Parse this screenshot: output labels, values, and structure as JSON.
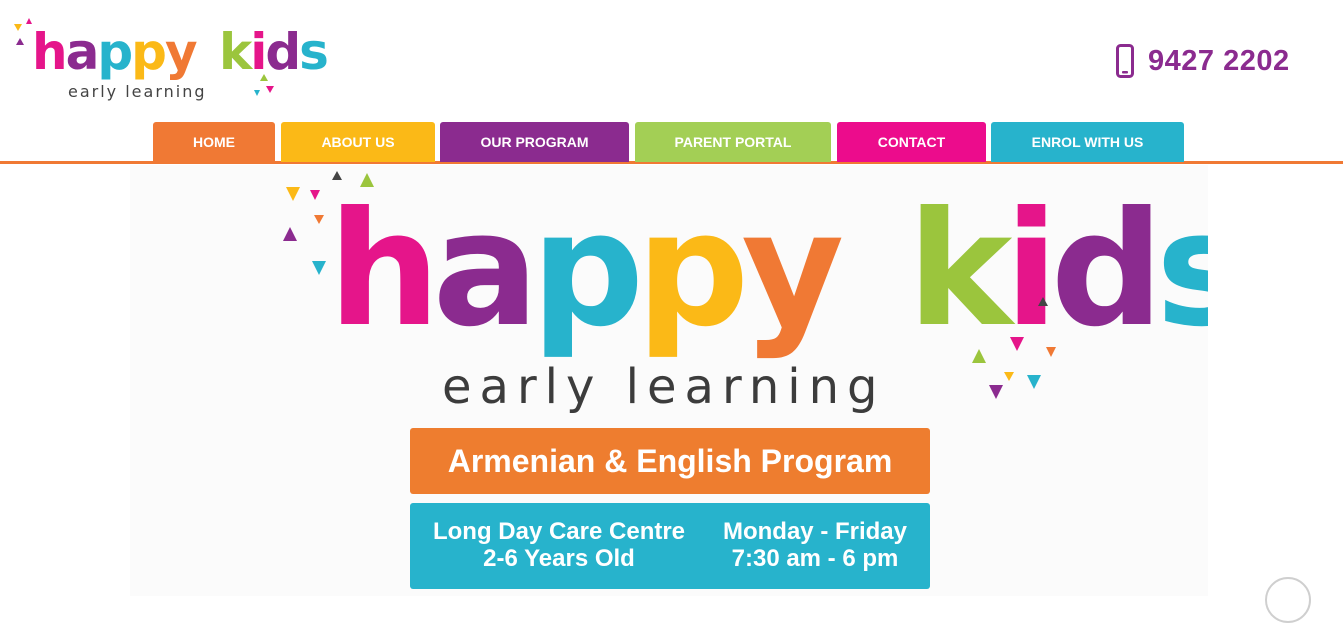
{
  "logo": {
    "letters": [
      {
        "ch": "h",
        "color": "#e5158a"
      },
      {
        "ch": "a",
        "color": "#8b2b8f"
      },
      {
        "ch": "p",
        "color": "#27b3cc"
      },
      {
        "ch": "p",
        "color": "#fbb917"
      },
      {
        "ch": "y",
        "color": "#f07934"
      },
      {
        "ch": " ",
        "color": "#ffffff"
      },
      {
        "ch": "k",
        "color": "#9bc53d"
      },
      {
        "ch": "i",
        "color": "#e5158a"
      },
      {
        "ch": "d",
        "color": "#8b2b8f"
      },
      {
        "ch": "s",
        "color": "#27b3cc"
      }
    ],
    "subtitle": "early learning"
  },
  "header": {
    "phone": "9427 2202",
    "phone_icon": "mobile-phone-icon"
  },
  "nav": {
    "items": [
      {
        "label": "HOME",
        "color": "#f07934"
      },
      {
        "label": "ABOUT US",
        "color": "#fbb917"
      },
      {
        "label": "OUR PROGRAM",
        "color": "#8b2b8f"
      },
      {
        "label": "PARENT PORTAL",
        "color": "#a3cf55"
      },
      {
        "label": "CONTACT",
        "color": "#ec0c8c"
      },
      {
        "label": "ENROL WITH US",
        "color": "#27b3cc"
      }
    ],
    "underline_color": "#f07934"
  },
  "banner": {
    "subtitle": "early learning",
    "program": "Armenian & English Program",
    "info_left": [
      "Long Day Care Centre",
      "2-6 Years Old"
    ],
    "info_right": [
      "Monday - Friday",
      "7:30 am - 6 pm"
    ]
  },
  "scroll_top_icon": "scroll-to-top-icon"
}
